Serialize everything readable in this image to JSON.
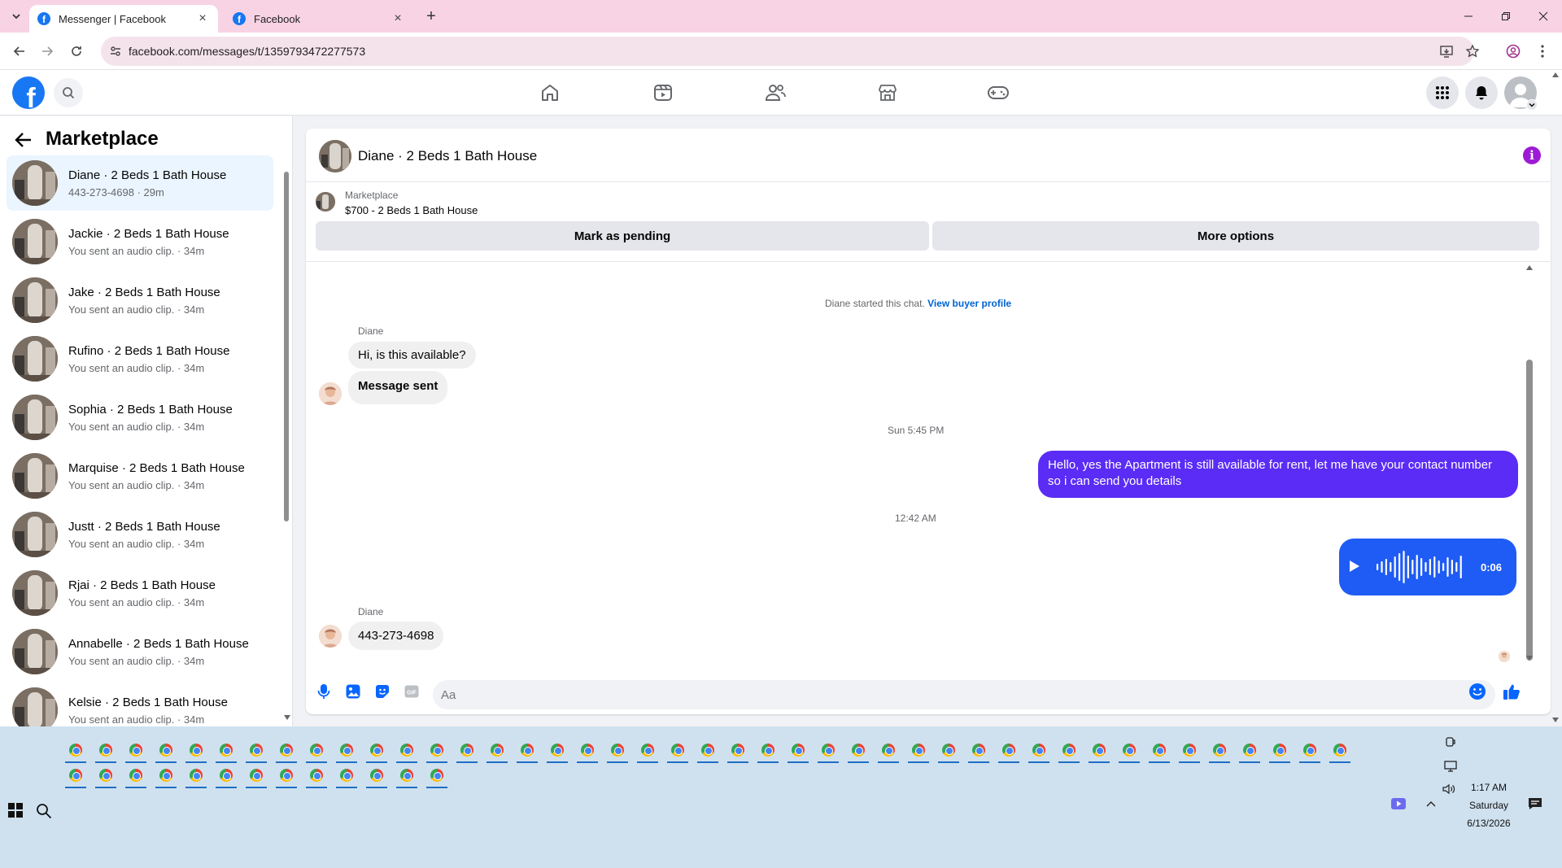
{
  "browser": {
    "tabs": [
      {
        "label": "Messenger | Facebook",
        "active": true
      },
      {
        "label": "Facebook",
        "active": false
      }
    ],
    "url": "facebook.com/messages/t/1359793472277573"
  },
  "header": {
    "logo_letter": "f",
    "nav_icons": [
      "home-icon",
      "video-icon",
      "friends-icon",
      "marketplace-icon",
      "gaming-icon"
    ],
    "right_icons": [
      "menu-grid-icon",
      "notifications-bell-icon",
      "account-avatar"
    ]
  },
  "sidebar": {
    "title": "Marketplace",
    "conversations": [
      {
        "name": "Diane · 2 Beds 1 Bath House",
        "preview": "443-273-4698 · 29m"
      },
      {
        "name": "Jackie · 2 Beds 1 Bath House",
        "preview": "You sent an audio clip. · 34m"
      },
      {
        "name": "Jake · 2 Beds 1 Bath House",
        "preview": "You sent an audio clip. · 34m"
      },
      {
        "name": "Rufino · 2 Beds 1 Bath House",
        "preview": "You sent an audio clip. · 34m"
      },
      {
        "name": "Sophia · 2 Beds 1 Bath House",
        "preview": "You sent an audio clip. · 34m"
      },
      {
        "name": "Marquise · 2 Beds 1 Bath House",
        "preview": "You sent an audio clip. · 34m"
      },
      {
        "name": "Justt · 2 Beds 1 Bath House",
        "preview": "You sent an audio clip. · 34m"
      },
      {
        "name": "Rjai · 2 Beds 1 Bath House",
        "preview": "You sent an audio clip. · 34m"
      },
      {
        "name": "Annabelle · 2 Beds 1 Bath House",
        "preview": "You sent an audio clip. · 34m"
      },
      {
        "name": "Kelsie · 2 Beds 1 Bath House",
        "preview": "You sent an audio clip. · 34m"
      }
    ]
  },
  "chat": {
    "title": "Diane · 2 Beds 1 Bath House",
    "listing": {
      "label": "Marketplace",
      "price_title": "$700 - 2 Beds 1 Bath House",
      "mark_pending": "Mark as pending",
      "more_options": "More options"
    },
    "started_text": "Diane started this chat.",
    "view_profile": "View buyer profile",
    "sender_name": "Diane",
    "msg1": "Hi, is this available?",
    "msg2": "Message sent",
    "ts1": "Sun 5:45 PM",
    "out_msg": "Hello, yes the Apartment is still available for rent, let me have your contact number so i can send you details",
    "ts2": "12:42 AM",
    "audio_duration": "0:06",
    "sender_name2": "Diane",
    "msg3": "443-273-4698",
    "composer_placeholder": "Aa"
  },
  "taskbar": {
    "time": "1:17 AM",
    "day": "Saturday",
    "date": "6/13/2026"
  },
  "colors": {
    "brand": "#1877f2",
    "outgoing_bubble": "#5b2cf5",
    "audio_bubble": "#1f5cf5",
    "info_icon": "#9d1bd6"
  }
}
